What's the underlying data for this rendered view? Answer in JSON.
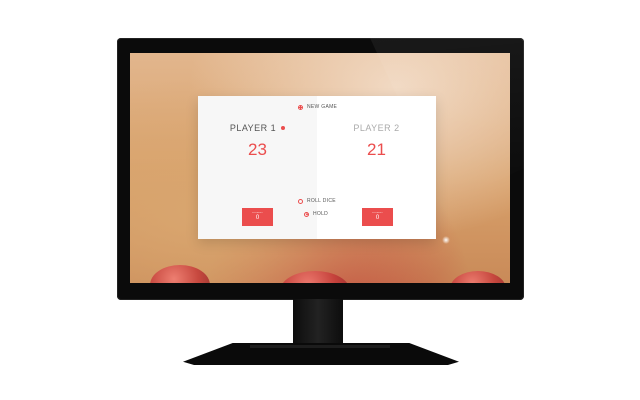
{
  "game": {
    "new_game_label": "NEW GAME",
    "roll_dice_label": "ROLL DICE",
    "hold_label": "HOLD",
    "active_player": 1,
    "players": [
      {
        "name": "PLAYER 1",
        "score": "23",
        "current_label": "Current",
        "current_value": "0"
      },
      {
        "name": "PLAYER 2",
        "score": "21",
        "current_label": "Current",
        "current_value": "0"
      }
    ]
  },
  "colors": {
    "accent": "#eb4d4d",
    "panel_bg": "#ffffff",
    "monitor_frame": "#0b0b0b"
  },
  "icons": {
    "new_game": "plus-circle-icon",
    "roll_dice": "circle-icon",
    "hold": "down-chevron-circle-icon"
  }
}
